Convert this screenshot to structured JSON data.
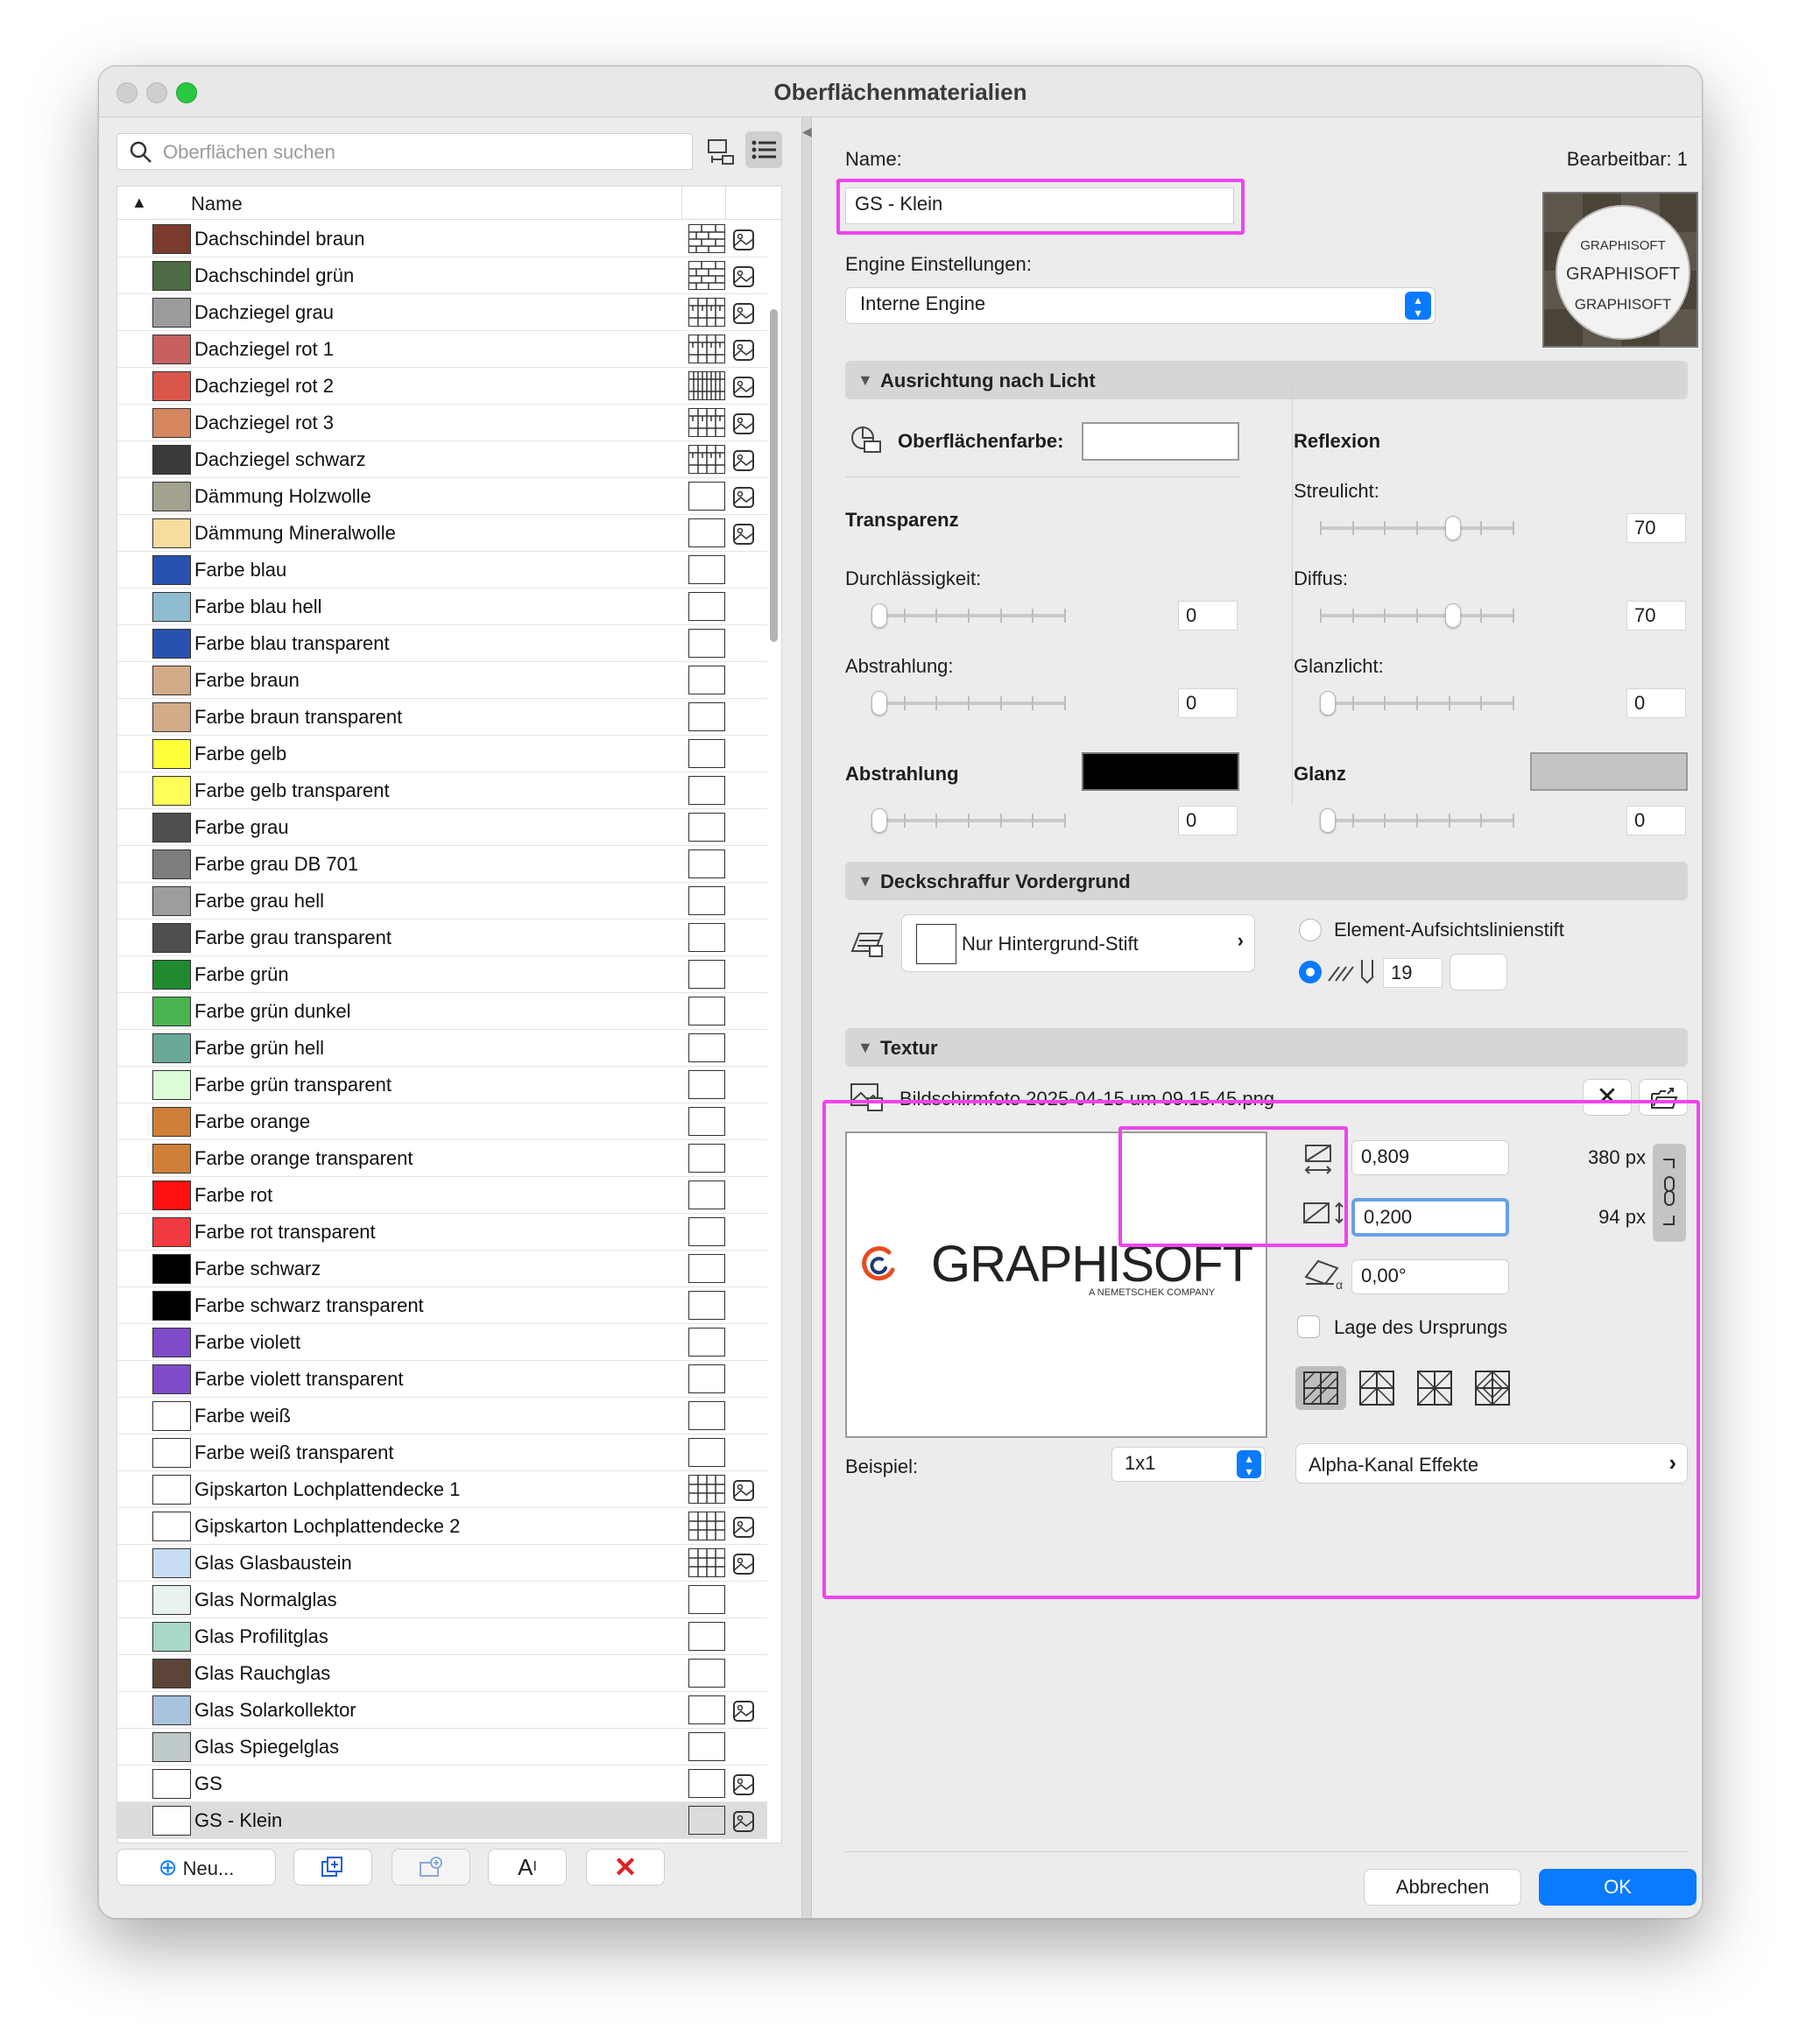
{
  "window": {
    "title": "Oberflächenmaterialien"
  },
  "search": {
    "placeholder": "Oberflächen suchen"
  },
  "list": {
    "header": "Name",
    "rows": [
      {
        "name": "Dachschindel braun",
        "color": "#7a3b2e",
        "hatch": "brick",
        "tex": true
      },
      {
        "name": "Dachschindel grün",
        "color": "#4d6b44",
        "hatch": "brick",
        "tex": true
      },
      {
        "name": "Dachziegel grau",
        "color": "#9c9c9c",
        "hatch": "tile",
        "tex": true
      },
      {
        "name": "Dachziegel rot 1",
        "color": "#c66060",
        "hatch": "tile",
        "tex": true
      },
      {
        "name": "Dachziegel rot 2",
        "color": "#d9574a",
        "hatch": "dense",
        "tex": true
      },
      {
        "name": "Dachziegel rot 3",
        "color": "#d4875f",
        "hatch": "tile",
        "tex": true
      },
      {
        "name": "Dachziegel schwarz",
        "color": "#3a3a3a",
        "hatch": "tile",
        "tex": true
      },
      {
        "name": "Dämmung Holzwolle",
        "color": "#a2a28f",
        "hatch": "none",
        "tex": true
      },
      {
        "name": "Dämmung Mineralwolle",
        "color": "#f6dc9e",
        "hatch": "none",
        "tex": true
      },
      {
        "name": "Farbe blau",
        "color": "#2752b0",
        "hatch": "none",
        "tex": false
      },
      {
        "name": "Farbe blau hell",
        "color": "#8fbcd1",
        "hatch": "none",
        "tex": false
      },
      {
        "name": "Farbe blau transparent",
        "color": "#2752b0",
        "hatch": "none",
        "tex": false
      },
      {
        "name": "Farbe braun",
        "color": "#d2ab88",
        "hatch": "none",
        "tex": false
      },
      {
        "name": "Farbe braun transparent",
        "color": "#d2ab88",
        "hatch": "none",
        "tex": false
      },
      {
        "name": "Farbe gelb",
        "color": "#ffff3c",
        "hatch": "none",
        "tex": false
      },
      {
        "name": "Farbe gelb transparent",
        "color": "#ffff58",
        "hatch": "none",
        "tex": false
      },
      {
        "name": "Farbe grau",
        "color": "#4f4f4f",
        "hatch": "none",
        "tex": false
      },
      {
        "name": "Farbe grau DB 701",
        "color": "#7d7d7d",
        "hatch": "none",
        "tex": false
      },
      {
        "name": "Farbe grau hell",
        "color": "#9d9d9d",
        "hatch": "none",
        "tex": false
      },
      {
        "name": "Farbe grau transparent",
        "color": "#4f4f4f",
        "hatch": "none",
        "tex": false
      },
      {
        "name": "Farbe grün",
        "color": "#1f8a2e",
        "hatch": "none",
        "tex": false
      },
      {
        "name": "Farbe grün dunkel",
        "color": "#49b350",
        "hatch": "none",
        "tex": false
      },
      {
        "name": "Farbe grün hell",
        "color": "#6aa898",
        "hatch": "none",
        "tex": false
      },
      {
        "name": "Farbe grün transparent",
        "color": "#dcfbd7",
        "hatch": "none",
        "tex": false
      },
      {
        "name": "Farbe orange",
        "color": "#cf7f37",
        "hatch": "none",
        "tex": false
      },
      {
        "name": "Farbe orange transparent",
        "color": "#cf7f37",
        "hatch": "none",
        "tex": false
      },
      {
        "name": "Farbe rot",
        "color": "#ff1010",
        "hatch": "none",
        "tex": false
      },
      {
        "name": "Farbe rot transparent",
        "color": "#f23a40",
        "hatch": "none",
        "tex": false
      },
      {
        "name": "Farbe schwarz",
        "color": "#000000",
        "hatch": "none",
        "tex": false
      },
      {
        "name": "Farbe schwarz transparent",
        "color": "#000000",
        "hatch": "none",
        "tex": false
      },
      {
        "name": "Farbe violett",
        "color": "#7f4cc9",
        "hatch": "none",
        "tex": false
      },
      {
        "name": "Farbe violett transparent",
        "color": "#7f4cc9",
        "hatch": "none",
        "tex": false
      },
      {
        "name": "Farbe weiß",
        "color": "#ffffff",
        "hatch": "none",
        "tex": false
      },
      {
        "name": "Farbe weiß transparent",
        "color": "#ffffff",
        "hatch": "none",
        "tex": false
      },
      {
        "name": "Gipskarton Lochplattendecke 1",
        "color": "#ffffff",
        "hatch": "grid",
        "tex": true
      },
      {
        "name": "Gipskarton Lochplattendecke 2",
        "color": "#ffffff",
        "hatch": "grid",
        "tex": true
      },
      {
        "name": "Glas Glasbaustein",
        "color": "#c9dcf6",
        "hatch": "grid",
        "tex": true
      },
      {
        "name": "Glas Normalglas",
        "color": "#e8f3ee",
        "hatch": "none",
        "tex": false
      },
      {
        "name": "Glas Profilitglas",
        "color": "#a9d8c8",
        "hatch": "none",
        "tex": false
      },
      {
        "name": "Glas Rauchglas",
        "color": "#5d4438",
        "hatch": "none",
        "tex": false
      },
      {
        "name": "Glas Solarkollektor",
        "color": "#a9c3df",
        "hatch": "none",
        "tex": true
      },
      {
        "name": "Glas Spiegelglas",
        "color": "#bfcaca",
        "hatch": "none",
        "tex": false
      },
      {
        "name": "GS",
        "color": "#ffffff",
        "hatch": "none",
        "tex": true
      },
      {
        "name": "GS - Klein",
        "color": "#ffffff",
        "hatch": "none",
        "tex": true,
        "selected": true
      }
    ]
  },
  "bottom_buttons": {
    "new": "Neu..."
  },
  "editor": {
    "name_label": "Name:",
    "editable": "Bearbeitbar: 1",
    "name_value": "GS - Klein",
    "engine_label": "Engine Einstellungen:",
    "engine_value": "Interne Engine",
    "preview_text": "GRAPHISOFT"
  },
  "light": {
    "section": "Ausrichtung nach Licht",
    "surface_color_label": "Oberflächenfarbe:",
    "reflection_title": "Reflexion",
    "transparency_title": "Transparenz",
    "sliders": [
      {
        "label": "Streulicht:",
        "value": "70",
        "level": 0.7
      },
      {
        "label": "Durchlässigkeit:",
        "value": "0",
        "level": 0
      },
      {
        "label": "Diffus:",
        "value": "70",
        "level": 0.7
      },
      {
        "label": "Abstrahlung:",
        "value": "0",
        "level": 0
      },
      {
        "label": "Glanzlicht:",
        "value": "0",
        "level": 0
      }
    ],
    "emission_label": "Abstrahlung",
    "emission_value": "0",
    "emission_color": "#000000",
    "gloss_label": "Glanz",
    "gloss_value": "0",
    "gloss_color": "#c4c4c4"
  },
  "hatch": {
    "section": "Deckschraffur Vordergrund",
    "pen_label": "Nur Hintergrund-Stift",
    "radio1": "Element-Aufsichtslinienstift",
    "pen_number": "19"
  },
  "texture": {
    "section": "Textur",
    "filename": "Bildschirmfoto 2025-04-15 um 09.15.45.png",
    "logo_text": "GRAPHISOFT",
    "logo_sub": "A NEMETSCHEK COMPANY",
    "width": "0,809",
    "height": "0,200",
    "width_px": "380 px",
    "height_px": "94 px",
    "angle": "0,00°",
    "origin_label": "Lage des Ursprungs",
    "sample_label": "Beispiel:",
    "sample_value": "1x1",
    "alpha_label": "Alpha-Kanal Effekte"
  },
  "footer": {
    "cancel": "Abbrechen",
    "ok": "OK"
  },
  "colors": {
    "accent": "#0a7aff",
    "highlight": "#ee44ee"
  }
}
